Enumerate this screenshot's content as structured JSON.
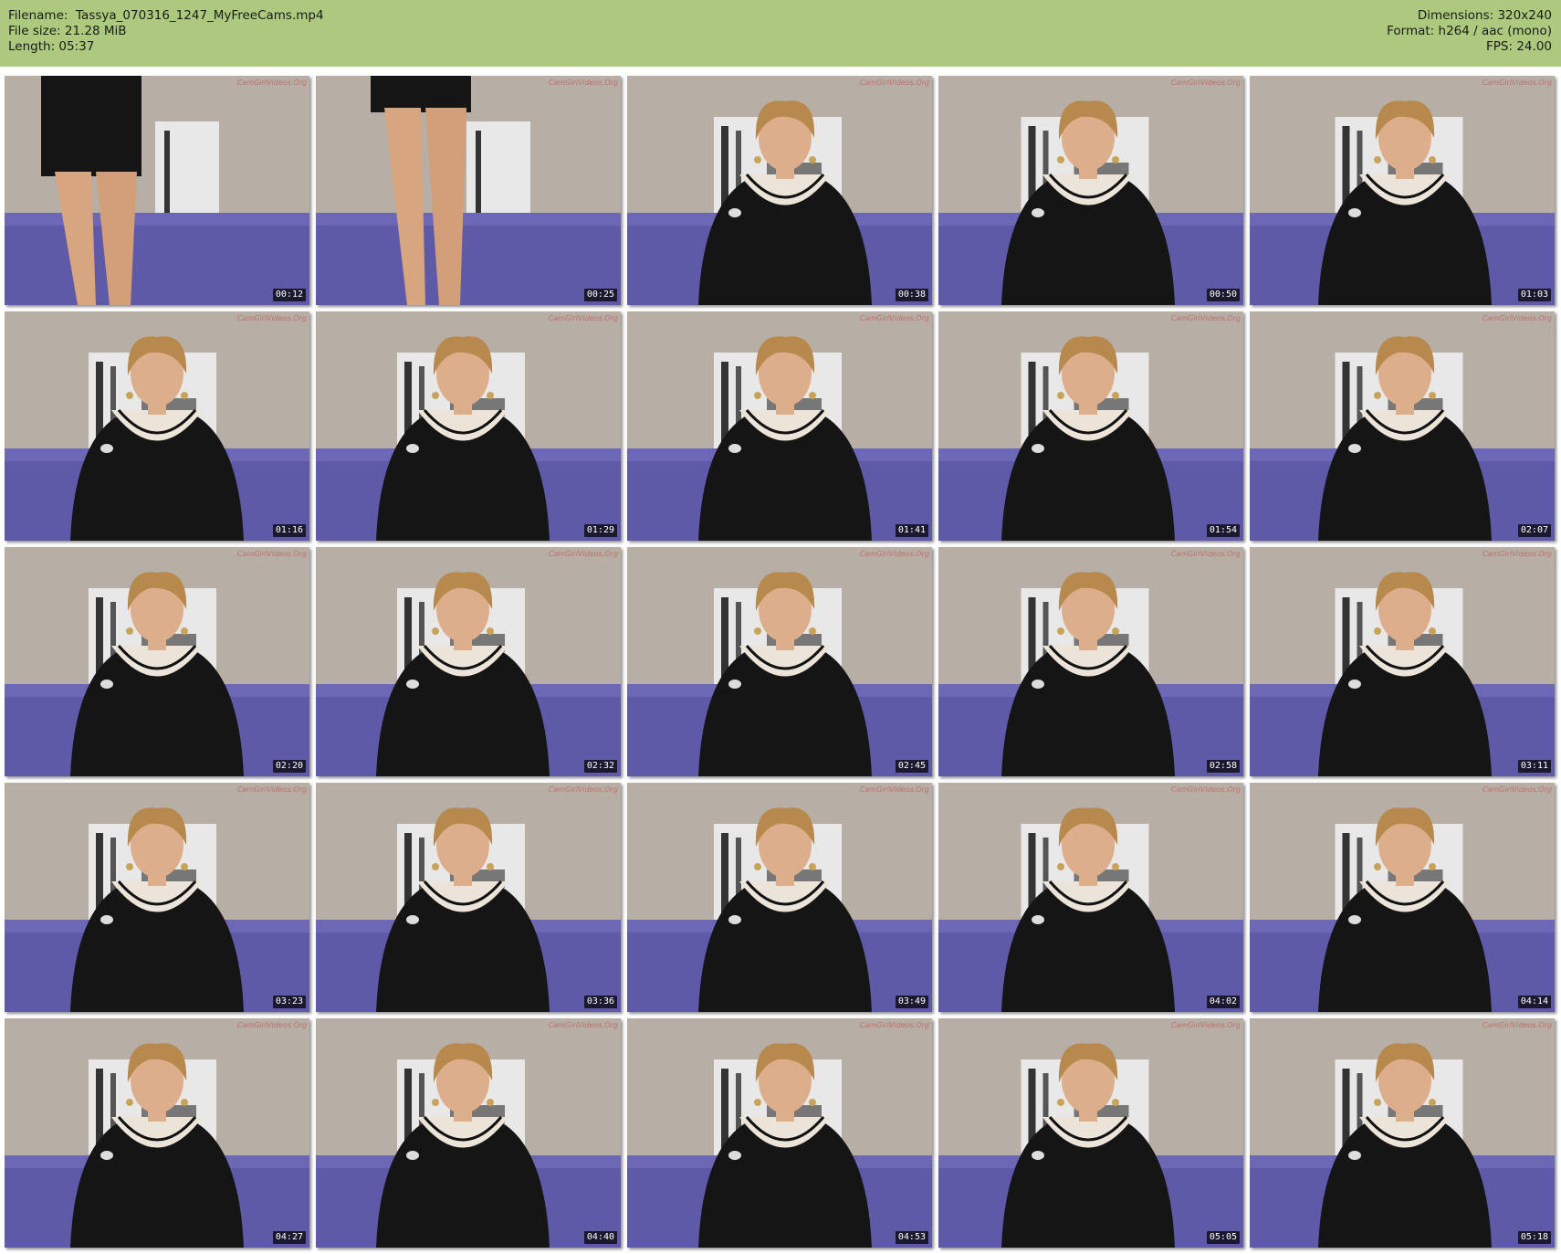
{
  "header": {
    "filename_label": "Filename:",
    "filename": "Tassya_070316_1247_MyFreeCams.mp4",
    "filesize_label": "File size:",
    "filesize": "21.28 MiB",
    "length_label": "Length:",
    "length": "05:37",
    "dimensions_label": "Dimensions:",
    "dimensions": "320x240",
    "format_label": "Format:",
    "format": "h264 / aac (mono)",
    "fps_label": "FPS:",
    "fps": "24.00"
  },
  "watermark": "CamGirlVideos.Org",
  "thumbnails": [
    {
      "time": "00:12",
      "scene": "legs"
    },
    {
      "time": "00:25",
      "scene": "legs"
    },
    {
      "time": "00:38",
      "scene": "person"
    },
    {
      "time": "00:50",
      "scene": "person"
    },
    {
      "time": "01:03",
      "scene": "person"
    },
    {
      "time": "01:16",
      "scene": "person"
    },
    {
      "time": "01:29",
      "scene": "person"
    },
    {
      "time": "01:41",
      "scene": "person"
    },
    {
      "time": "01:54",
      "scene": "person"
    },
    {
      "time": "02:07",
      "scene": "person"
    },
    {
      "time": "02:20",
      "scene": "person"
    },
    {
      "time": "02:32",
      "scene": "person"
    },
    {
      "time": "02:45",
      "scene": "person"
    },
    {
      "time": "02:58",
      "scene": "person"
    },
    {
      "time": "03:11",
      "scene": "person"
    },
    {
      "time": "03:23",
      "scene": "person"
    },
    {
      "time": "03:36",
      "scene": "person"
    },
    {
      "time": "03:49",
      "scene": "person"
    },
    {
      "time": "04:02",
      "scene": "person"
    },
    {
      "time": "04:14",
      "scene": "person"
    },
    {
      "time": "04:27",
      "scene": "person"
    },
    {
      "time": "04:40",
      "scene": "person"
    },
    {
      "time": "04:53",
      "scene": "person"
    },
    {
      "time": "05:05",
      "scene": "person"
    },
    {
      "time": "05:18",
      "scene": "person"
    }
  ],
  "colors": {
    "header_bg": "#acc97e",
    "wall": "#b7aea6",
    "sofa": "#5f5aa8",
    "dress": "#151515",
    "collar": "#ece4d9",
    "hair": "#b8894c",
    "skin": "#dcae8c"
  }
}
